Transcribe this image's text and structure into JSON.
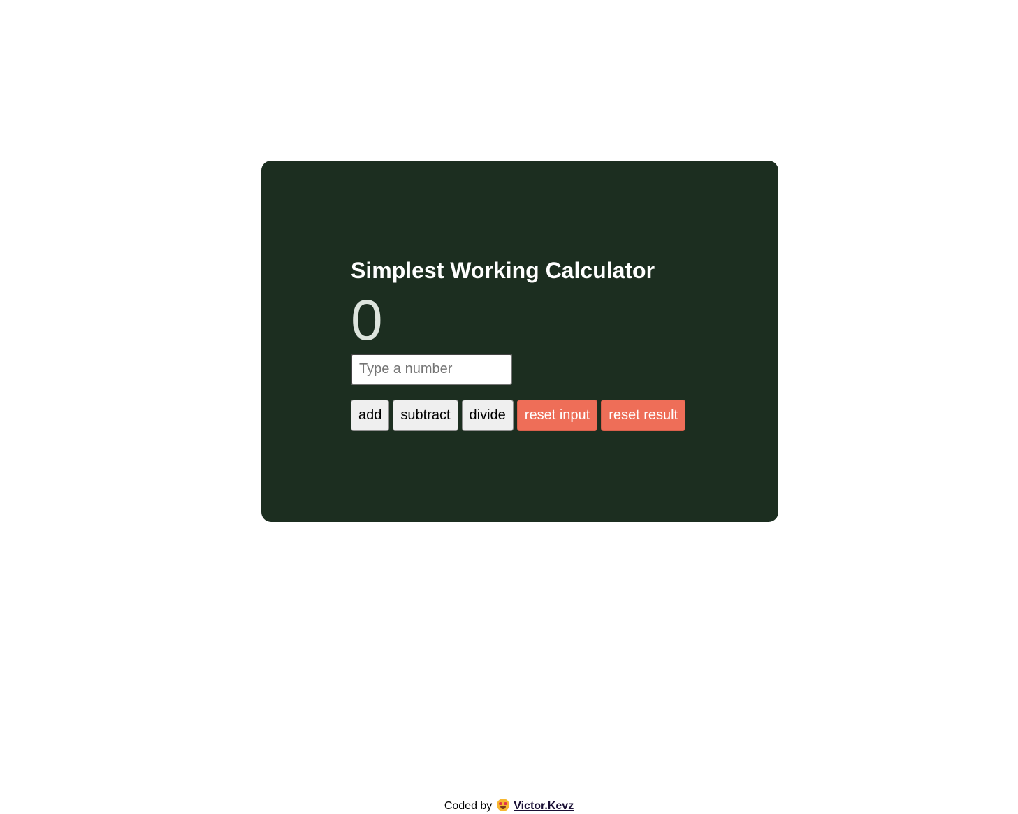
{
  "calculator": {
    "title": "Simplest Working Calculator",
    "result": "0",
    "input_placeholder": "Type a number",
    "input_value": "",
    "buttons": {
      "add": "add",
      "subtract": "subtract",
      "divide": "divide",
      "reset_input": "reset input",
      "reset_result": "reset result"
    }
  },
  "footer": {
    "prefix": "Coded by",
    "emoji_icon": "heart-eyes-emoji-icon",
    "author": "Victor.Kevz"
  },
  "colors": {
    "card_background": "#1c2e20",
    "reset_button": "#ee6e58",
    "title_text": "#ffffff"
  }
}
